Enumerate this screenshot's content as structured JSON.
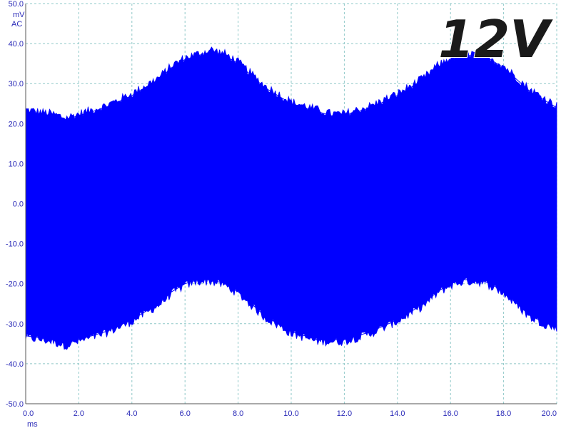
{
  "chart_data": {
    "type": "line",
    "overlay_label": "12V",
    "y_units": [
      "mV",
      "AC"
    ],
    "x_unit": "ms",
    "xlim": [
      0.0,
      20.0
    ],
    "ylim": [
      -50.0,
      50.0
    ],
    "x_ticks": [
      "0.0",
      "2.0",
      "4.0",
      "6.0",
      "8.0",
      "10.0",
      "12.0",
      "14.0",
      "16.0",
      "18.0",
      "20.0"
    ],
    "y_ticks": [
      "50.0",
      "40.0",
      "30.0",
      "20.0",
      "10.0",
      "0.0",
      "-10.0",
      "-20.0",
      "-30.0",
      "-40.0",
      "-50.0"
    ],
    "grid": true,
    "series": [
      {
        "color": "#0000ff",
        "upper_envelope": {
          "x": [
            0.0,
            1.0,
            1.5,
            2.0,
            3.0,
            4.0,
            5.0,
            5.5,
            6.0,
            6.5,
            7.0,
            7.5,
            8.0,
            8.5,
            9.0,
            10.0,
            11.0,
            11.5,
            12.0,
            13.0,
            14.0,
            15.0,
            15.5,
            16.0,
            16.5,
            17.0,
            17.5,
            18.0,
            18.5,
            19.0,
            20.0
          ],
          "y": [
            23,
            22,
            21,
            22,
            24,
            27,
            31,
            34,
            36,
            37,
            38,
            37,
            35,
            32,
            29,
            25,
            23,
            22,
            22,
            24,
            27,
            31,
            34,
            36,
            37,
            37,
            36,
            34,
            31,
            28,
            24
          ]
        },
        "lower_envelope": {
          "x": [
            0.0,
            1.0,
            1.5,
            2.0,
            3.0,
            4.0,
            5.0,
            5.5,
            6.0,
            6.5,
            7.0,
            7.5,
            8.0,
            8.5,
            9.0,
            10.0,
            11.0,
            11.5,
            12.0,
            13.0,
            14.0,
            15.0,
            15.5,
            16.0,
            16.5,
            17.0,
            17.5,
            18.0,
            18.5,
            19.0,
            20.0
          ],
          "y": [
            -33,
            -34,
            -35,
            -34,
            -32,
            -29,
            -25,
            -22,
            -20,
            -19,
            -19,
            -20,
            -22,
            -25,
            -28,
            -32,
            -34,
            -34,
            -34,
            -32,
            -29,
            -25,
            -22,
            -20,
            -19,
            -19,
            -20,
            -22,
            -25,
            -28,
            -31
          ]
        }
      }
    ]
  }
}
